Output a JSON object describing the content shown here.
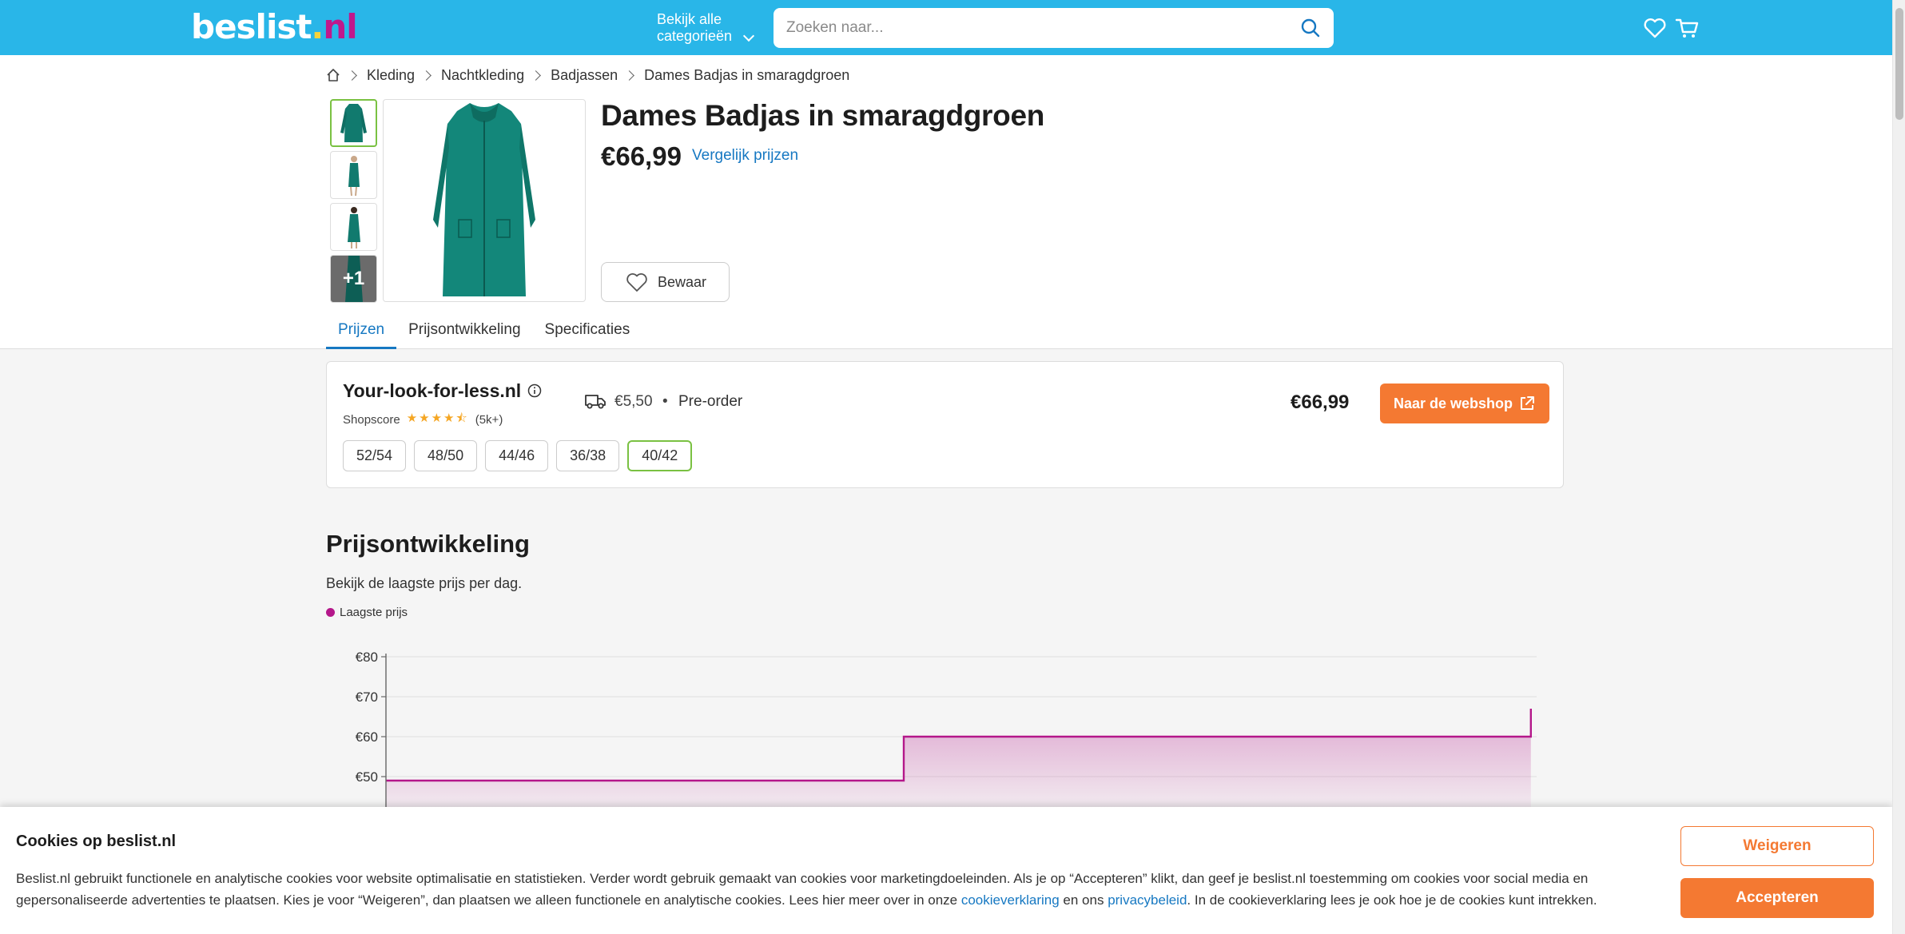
{
  "header": {
    "logo": {
      "main": "beslist",
      "dot": ".",
      "tld": "nl"
    },
    "categories_line1": "Bekijk alle",
    "categories_line2": "categorieën",
    "search_placeholder": "Zoeken naar...",
    "icons": [
      "search-icon",
      "heart-icon",
      "cart-icon"
    ]
  },
  "breadcrumb": {
    "items": [
      "Kleding",
      "Nachtkleding",
      "Badjassen",
      "Dames Badjas in smaragdgroen"
    ]
  },
  "gallery": {
    "more_label": "+1"
  },
  "product": {
    "title": "Dames Badjas in smaragdgroen",
    "price": "€66,99",
    "compare_label": "Vergelijk prijzen",
    "save_label": "Bewaar"
  },
  "tabs": [
    "Prijzen",
    "Prijsontwikkeling",
    "Specificaties"
  ],
  "offer": {
    "shop_name": "Your-look-for-less.nl",
    "shopscore_label": "Shopscore",
    "rating": 4.5,
    "reviews": "(5k+)",
    "shipping": "€5,50",
    "separator": "•",
    "availability": "Pre-order",
    "price": "€66,99",
    "button_label": "Naar de webshop",
    "sizes": [
      "52/54",
      "48/50",
      "44/46",
      "36/38",
      "40/42"
    ],
    "selected_size": "40/42"
  },
  "price_history": {
    "title": "Prijsontwikkeling",
    "subtitle": "Bekijk de laagste prijs per dag.",
    "legend": "Laagste prijs"
  },
  "chart_data": {
    "type": "area",
    "series": [
      {
        "name": "Laagste prijs",
        "values": [
          49,
          49,
          60,
          60,
          67
        ]
      }
    ],
    "x": [
      0,
      0.45,
      0.45,
      0.995,
      0.995
    ],
    "ytick_labels": [
      "€80",
      "€70",
      "€60",
      "€50"
    ],
    "yticks": [
      80,
      70,
      60,
      50
    ],
    "ylim": [
      40,
      80
    ],
    "grid": true,
    "color": "#b4178a",
    "legend_position": "top-left"
  },
  "cookie": {
    "title": "Cookies op beslist.nl",
    "text_part1": "Beslist.nl gebruikt functionele en analytische cookies voor website optimalisatie en statistieken. Verder wordt gebruik gemaakt van cookies voor marketingdoeleinden. Als je op “Accepteren” klikt, dan geef je beslist.nl toestemming om cookies voor social media en gepersonaliseerde advertenties te plaatsen. Kies je voor “Weigeren”, dan plaatsen we alleen functionele en analytische cookies. Lees hier meer over in onze ",
    "link_cookie": "cookieverklaring",
    "text_part2": " en ons ",
    "link_privacy": "privacybeleid",
    "text_part3": ". In de cookieverklaring lees je ook hoe je de cookies kunt intrekken.",
    "reject_label": "Weigeren",
    "accept_label": "Accepteren"
  },
  "colors": {
    "header_bg": "#29b6e8",
    "accent_orange": "#f47932",
    "link_blue": "#1678c2",
    "selected_green": "#7ac142",
    "chart_line": "#b4178a"
  }
}
